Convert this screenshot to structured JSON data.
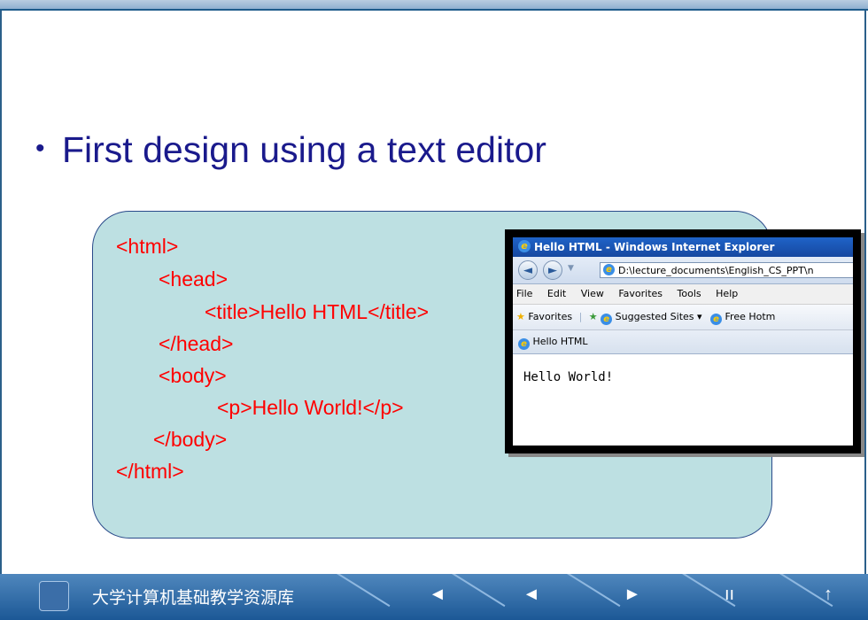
{
  "slide": {
    "bullet": "First design using a text editor"
  },
  "code_lines": [
    "<html>",
    "<head>",
    "<title>Hello HTML</title>",
    "</head>",
    "<body>",
    "<p>Hello World!</p>",
    "</body>",
    "</html>"
  ],
  "browser": {
    "title": "Hello HTML - Windows Internet Explorer",
    "address": "D:\\lecture_documents\\English_CS_PPT\\n",
    "menu": [
      "File",
      "Edit",
      "View",
      "Favorites",
      "Tools",
      "Help"
    ],
    "favorites_label": "Favorites",
    "suggested_sites": "Suggested Sites ▾",
    "free_hotmail": "Free Hotm",
    "tab_label": "Hello HTML",
    "content": "Hello World!"
  },
  "footer": {
    "library_label": "大学计算机基础教学资源库",
    "controls": [
      "◄",
      "◄",
      "►",
      "ıı",
      "↑"
    ]
  },
  "colors": {
    "code_text": "#ff0000",
    "bullet_text": "#1a1a8c",
    "code_box_bg": "#bde0e2",
    "footer_bg": "#1c5896"
  }
}
